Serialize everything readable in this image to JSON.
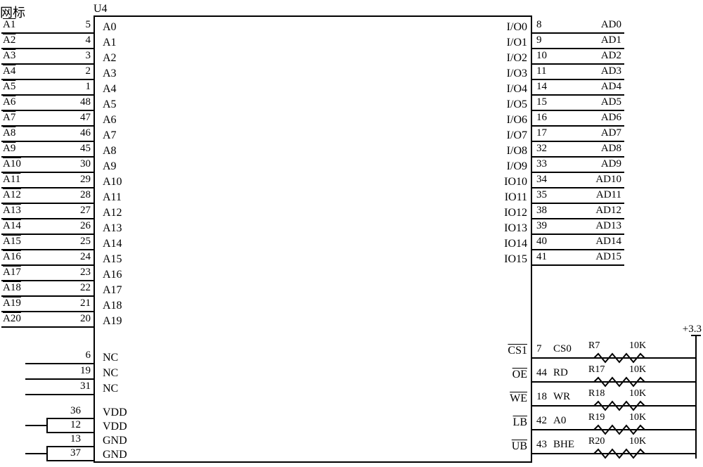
{
  "title_cn": "网标",
  "refdes": "U4",
  "left_address": [
    {
      "net": "A1",
      "pin": "5",
      "name": "A0"
    },
    {
      "net": "A2",
      "pin": "4",
      "name": "A1"
    },
    {
      "net": "A3",
      "pin": "3",
      "name": "A2"
    },
    {
      "net": "A4",
      "pin": "2",
      "name": "A3"
    },
    {
      "net": "A5",
      "pin": "1",
      "name": "A4"
    },
    {
      "net": "A6",
      "pin": "48",
      "name": "A5"
    },
    {
      "net": "A7",
      "pin": "47",
      "name": "A6"
    },
    {
      "net": "A8",
      "pin": "46",
      "name": "A7"
    },
    {
      "net": "A9",
      "pin": "45",
      "name": "A8"
    },
    {
      "net": "A10",
      "pin": "30",
      "name": "A9"
    },
    {
      "net": "A11",
      "pin": "29",
      "name": "A10"
    },
    {
      "net": "A12",
      "pin": "28",
      "name": "A11"
    },
    {
      "net": "A13",
      "pin": "27",
      "name": "A12"
    },
    {
      "net": "A14",
      "pin": "26",
      "name": "A13"
    },
    {
      "net": "A15",
      "pin": "25",
      "name": "A14"
    },
    {
      "net": "A16",
      "pin": "24",
      "name": "A15"
    },
    {
      "net": "A17",
      "pin": "23",
      "name": "A16"
    },
    {
      "net": "A18",
      "pin": "22",
      "name": "A17"
    },
    {
      "net": "A19",
      "pin": "21",
      "name": "A18"
    },
    {
      "net": "A20",
      "pin": "20",
      "name": "A19"
    }
  ],
  "left_nc": [
    {
      "pin": "6",
      "name": "NC"
    },
    {
      "pin": "19",
      "name": "NC"
    },
    {
      "pin": "31",
      "name": "NC"
    }
  ],
  "left_power": [
    {
      "pin": "36",
      "name": "VDD"
    },
    {
      "pin": "12",
      "name": "VDD"
    },
    {
      "pin": "13",
      "name": "GND"
    },
    {
      "pin": "37",
      "name": "GND"
    }
  ],
  "right_io": [
    {
      "pin": "8",
      "name": "I/O0",
      "net": "AD0"
    },
    {
      "pin": "9",
      "name": "I/O1",
      "net": "AD1"
    },
    {
      "pin": "10",
      "name": "I/O2",
      "net": "AD2"
    },
    {
      "pin": "11",
      "name": "I/O3",
      "net": "AD3"
    },
    {
      "pin": "14",
      "name": "I/O4",
      "net": "AD4"
    },
    {
      "pin": "15",
      "name": "I/O5",
      "net": "AD5"
    },
    {
      "pin": "16",
      "name": "I/O6",
      "net": "AD6"
    },
    {
      "pin": "17",
      "name": "I/O7",
      "net": "AD7"
    },
    {
      "pin": "32",
      "name": "I/O8",
      "net": "AD8"
    },
    {
      "pin": "33",
      "name": "I/O9",
      "net": "AD9"
    },
    {
      "pin": "34",
      "name": "IO10",
      "net": "AD10"
    },
    {
      "pin": "35",
      "name": "IO11",
      "net": "AD11"
    },
    {
      "pin": "38",
      "name": "IO12",
      "net": "AD12"
    },
    {
      "pin": "39",
      "name": "IO13",
      "net": "AD13"
    },
    {
      "pin": "40",
      "name": "IO14",
      "net": "AD14"
    },
    {
      "pin": "41",
      "name": "IO15",
      "net": "AD15"
    }
  ],
  "right_ctrl": [
    {
      "pin": "7",
      "name": "CS1",
      "bar": true,
      "net": "CS0",
      "ref": "R7",
      "val": "10K"
    },
    {
      "pin": "44",
      "name": "OE",
      "bar": true,
      "net": "RD",
      "ref": "R17",
      "val": "10K"
    },
    {
      "pin": "18",
      "name": "WE",
      "bar": true,
      "net": "WR",
      "ref": "R18",
      "val": "10K"
    },
    {
      "pin": "42",
      "name": "LB",
      "bar": true,
      "net": "A0",
      "ref": "R19",
      "val": "10K"
    },
    {
      "pin": "43",
      "name": "UB",
      "bar": true,
      "net": "BHE",
      "ref": "R20",
      "val": "10K"
    }
  ],
  "vcc_label": "+3.3"
}
